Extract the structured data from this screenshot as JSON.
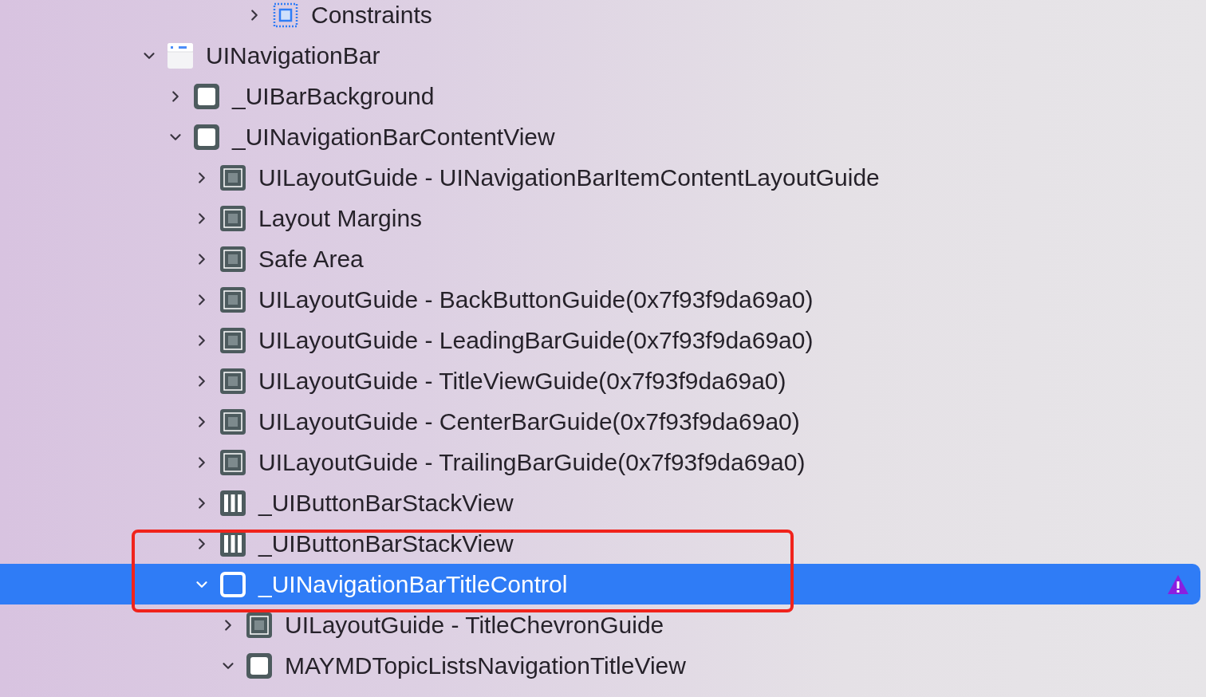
{
  "partial_branch": [
    {
      "label": "Constraints",
      "kind": "constraints",
      "expanded": false,
      "selected": false,
      "warning": false
    }
  ],
  "tree": [
    {
      "label": "UINavigationBar",
      "kind": "navbar",
      "expanded": true,
      "selected": false,
      "warning": false,
      "children": [
        {
          "label": "_UIBarBackground",
          "kind": "view",
          "expanded": false,
          "selected": false,
          "warning": false
        },
        {
          "label": "_UINavigationBarContentView",
          "kind": "view",
          "expanded": true,
          "selected": false,
          "warning": false,
          "children": [
            {
              "label": "UILayoutGuide - UINavigationBarItemContentLayoutGuide",
              "kind": "guide",
              "expanded": false,
              "selected": false,
              "warning": false
            },
            {
              "label": "Layout Margins",
              "kind": "guide",
              "expanded": false,
              "selected": false,
              "warning": false
            },
            {
              "label": "Safe Area",
              "kind": "guide",
              "expanded": false,
              "selected": false,
              "warning": false
            },
            {
              "label": "UILayoutGuide - BackButtonGuide(0x7f93f9da69a0)",
              "kind": "guide",
              "expanded": false,
              "selected": false,
              "warning": false
            },
            {
              "label": "UILayoutGuide - LeadingBarGuide(0x7f93f9da69a0)",
              "kind": "guide",
              "expanded": false,
              "selected": false,
              "warning": false
            },
            {
              "label": "UILayoutGuide - TitleViewGuide(0x7f93f9da69a0)",
              "kind": "guide",
              "expanded": false,
              "selected": false,
              "warning": false
            },
            {
              "label": "UILayoutGuide - CenterBarGuide(0x7f93f9da69a0)",
              "kind": "guide",
              "expanded": false,
              "selected": false,
              "warning": false
            },
            {
              "label": "UILayoutGuide - TrailingBarGuide(0x7f93f9da69a0)",
              "kind": "guide",
              "expanded": false,
              "selected": false,
              "warning": false
            },
            {
              "label": "_UIButtonBarStackView",
              "kind": "stack",
              "expanded": false,
              "selected": false,
              "warning": false
            },
            {
              "label": "_UIButtonBarStackView",
              "kind": "stack",
              "expanded": false,
              "selected": false,
              "warning": false
            },
            {
              "label": "_UINavigationBarTitleControl",
              "kind": "view",
              "expanded": true,
              "selected": true,
              "warning": true,
              "children": [
                {
                  "label": "UILayoutGuide - TitleChevronGuide",
                  "kind": "guide",
                  "expanded": false,
                  "selected": false,
                  "warning": false
                },
                {
                  "label": "MAYMDTopicListsNavigationTitleView",
                  "kind": "view",
                  "expanded": true,
                  "selected": false,
                  "warning": false
                }
              ]
            }
          ]
        }
      ]
    }
  ]
}
